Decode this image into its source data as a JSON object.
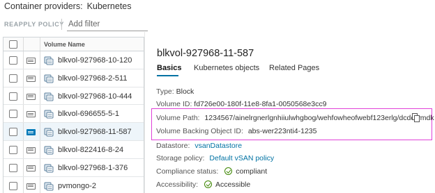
{
  "header": {
    "label": "Container providers:",
    "value": "Kubernetes"
  },
  "toolbar": {
    "reapply_label": "REAPPLY POLICY",
    "filter_placeholder": "Add filter"
  },
  "grid": {
    "column_header": "Volume Name",
    "rows": [
      {
        "label": "blkvol-927968-10-120",
        "selected": false
      },
      {
        "label": "blkvol-927968-2-511",
        "selected": false
      },
      {
        "label": "blkvol-927968-10-444",
        "selected": false
      },
      {
        "label": "blkvol-696655-5-1",
        "selected": false
      },
      {
        "label": "blkvol-927968-11-587",
        "selected": true
      },
      {
        "label": "blkvol-822416-8-24",
        "selected": false
      },
      {
        "label": "blkvol-927968-1-376",
        "selected": false
      },
      {
        "label": "pvmongo-2",
        "selected": false
      }
    ]
  },
  "detail": {
    "title": "blkvol-927968-11-587",
    "tabs": [
      {
        "label": "Basics",
        "active": true
      },
      {
        "label": "Kubernetes objects",
        "active": false
      },
      {
        "label": "Related Pages",
        "active": false
      }
    ],
    "type": {
      "label": "Type:",
      "value": "Block"
    },
    "volume_id": {
      "label": "Volume ID:",
      "value": "fd726e00-180f-11e8-8fa1-0050568e3cc9"
    },
    "volume_path": {
      "label": "Volume Path:",
      "value": "1234567/ainelrgnerlgnhiiulwhgbog/wehfowheofwebf123erlg/dcdc.vmdk"
    },
    "backing_id": {
      "label": "Volume Backing Object ID:",
      "value": "abs-wer223nti4-1235"
    },
    "datastore": {
      "label": "Datastore:",
      "value": "vsanDatastore"
    },
    "storage_policy": {
      "label": "Storage policy:",
      "value": "Default vSAN policy"
    },
    "compliance": {
      "label": "Compliance status:",
      "value": "compliant"
    },
    "accessibility": {
      "label": "Accessibility:",
      "value": "Accessible"
    }
  },
  "colors": {
    "accent": "#0072a3",
    "highlight": "#e040d8",
    "status_ok": "#3c8500"
  }
}
